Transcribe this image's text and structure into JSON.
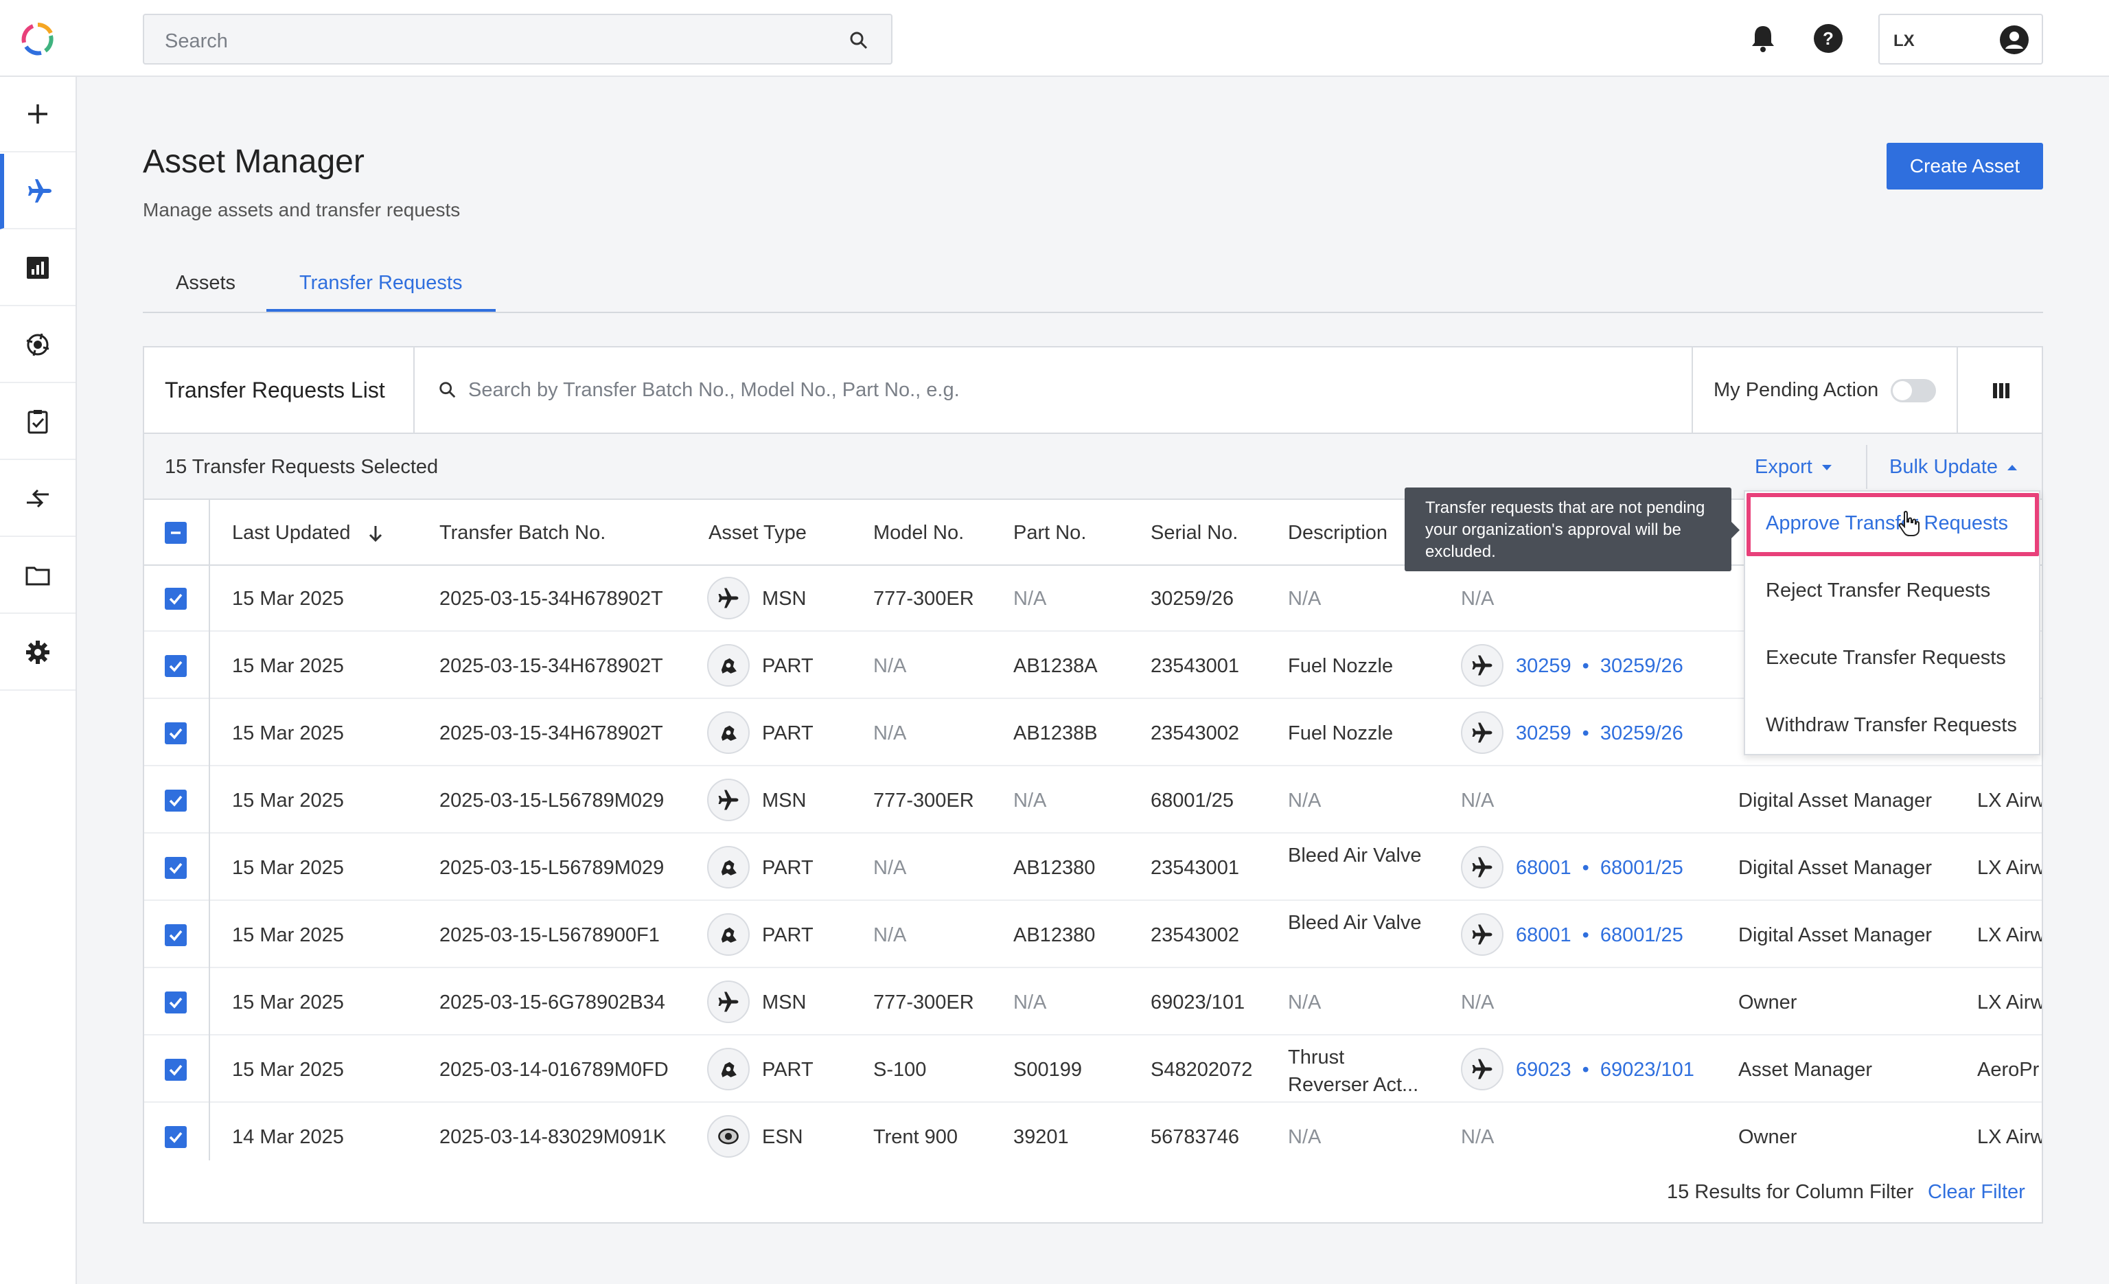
{
  "topbar": {
    "search_placeholder": "Search",
    "account_code": "LX"
  },
  "sidebar": {
    "items": [
      {
        "icon": "plus-icon"
      },
      {
        "icon": "airplane-icon",
        "active": true
      },
      {
        "icon": "chart-icon"
      },
      {
        "icon": "engine-icon"
      },
      {
        "icon": "clipboard-check-icon"
      },
      {
        "icon": "transfer-arrows-icon"
      },
      {
        "icon": "folder-icon"
      },
      {
        "icon": "gear-icon"
      }
    ]
  },
  "page": {
    "title": "Asset Manager",
    "subtitle": "Manage assets and transfer requests",
    "create_button": "Create Asset"
  },
  "tabs": [
    {
      "label": "Assets"
    },
    {
      "label": "Transfer Requests",
      "active": true
    }
  ],
  "list": {
    "title": "Transfer Requests List",
    "search_placeholder": "Search by Transfer Batch No., Model No., Part No., e.g.",
    "pending_label": "My Pending Action",
    "pending_on": false,
    "selected_text": "15 Transfer Requests Selected",
    "export_label": "Export",
    "bulk_label": "Bulk Update"
  },
  "columns": [
    "Last Updated",
    "Transfer Batch No.",
    "Asset Type",
    "Model No.",
    "Part No.",
    "Serial No.",
    "Description"
  ],
  "rows": [
    {
      "date": "15 Mar 2025",
      "batch": "2025-03-15-34H678902T",
      "icon": "airplane-icon",
      "type": "MSN",
      "model": "777-300ER",
      "part": "N/A",
      "serial": "30259/26",
      "desc": "N/A",
      "parent_a": "",
      "parent_b": "",
      "parent_na": "N/A",
      "role": "",
      "org": ""
    },
    {
      "date": "15 Mar 2025",
      "batch": "2025-03-15-34H678902T",
      "icon": "part-icon",
      "type": "PART",
      "model": "N/A",
      "part": "AB1238A",
      "serial": "23543001",
      "desc": "Fuel Nozzle",
      "parent_a": "30259",
      "parent_b": "30259/26",
      "parent_na": "",
      "role": "",
      "org": ""
    },
    {
      "date": "15 Mar 2025",
      "batch": "2025-03-15-34H678902T",
      "icon": "part-icon",
      "type": "PART",
      "model": "N/A",
      "part": "AB1238B",
      "serial": "23543002",
      "desc": "Fuel Nozzle",
      "parent_a": "30259",
      "parent_b": "30259/26",
      "parent_na": "",
      "role": "",
      "org": ""
    },
    {
      "date": "15 Mar 2025",
      "batch": "2025-03-15-L56789M029",
      "icon": "airplane-icon",
      "type": "MSN",
      "model": "777-300ER",
      "part": "N/A",
      "serial": "68001/25",
      "desc": "N/A",
      "parent_a": "",
      "parent_b": "",
      "parent_na": "N/A",
      "role": "Digital Asset Manager",
      "org": "LX Airw"
    },
    {
      "date": "15 Mar 2025",
      "batch": "2025-03-15-L56789M029",
      "icon": "part-icon",
      "type": "PART",
      "model": "N/A",
      "part": "AB12380",
      "serial": "23543001",
      "desc": "Bleed Air Valve",
      "parent_a": "68001",
      "parent_b": "68001/25",
      "parent_na": "",
      "role": "Digital Asset Manager",
      "org": "LX Airw"
    },
    {
      "date": "15 Mar 2025",
      "batch": "2025-03-15-L5678900F1",
      "icon": "part-icon",
      "type": "PART",
      "model": "N/A",
      "part": "AB12380",
      "serial": "23543002",
      "desc": "Bleed Air Valve",
      "parent_a": "68001",
      "parent_b": "68001/25",
      "parent_na": "",
      "role": "Digital Asset Manager",
      "org": "LX Airw"
    },
    {
      "date": "15 Mar 2025",
      "batch": "2025-03-15-6G78902B34",
      "icon": "airplane-icon",
      "type": "MSN",
      "model": "777-300ER",
      "part": "N/A",
      "serial": "69023/101",
      "desc": "N/A",
      "parent_a": "",
      "parent_b": "",
      "parent_na": "N/A",
      "role": "Owner",
      "org": "LX Airw"
    },
    {
      "date": "15 Mar 2025",
      "batch": "2025-03-14-016789M0FD",
      "icon": "part-icon",
      "type": "PART",
      "model": "S-100",
      "part": "S00199",
      "serial": "S48202072",
      "desc": "Thrust Reverser Act...",
      "parent_a": "69023",
      "parent_b": "69023/101",
      "parent_na": "",
      "role": "Asset Manager",
      "org": "AeroPr"
    },
    {
      "date": "14 Mar 2025",
      "batch": "2025-03-14-83029M091K",
      "icon": "engine-esn-icon",
      "type": "ESN",
      "model": "Trent 900",
      "part": "39201",
      "serial": "56783746",
      "desc": "N/A",
      "parent_a": "",
      "parent_b": "",
      "parent_na": "N/A",
      "role": "Owner",
      "org": "LX Airw"
    }
  ],
  "tooltip": {
    "text": "Transfer requests that are not pending your organization's approval will be excluded."
  },
  "bulk_menu": [
    {
      "label": "Approve Transfer Requests",
      "highlighted": true
    },
    {
      "label": "Reject Transfer Requests"
    },
    {
      "label": "Execute Transfer Requests"
    },
    {
      "label": "Withdraw Transfer Requests"
    }
  ],
  "footer": {
    "results": "15 Results for Column Filter",
    "clear": "Clear Filter"
  },
  "colors": {
    "accent": "#2f6fde",
    "highlight": "#e8407a",
    "tooltip_bg": "#4a4f57"
  }
}
